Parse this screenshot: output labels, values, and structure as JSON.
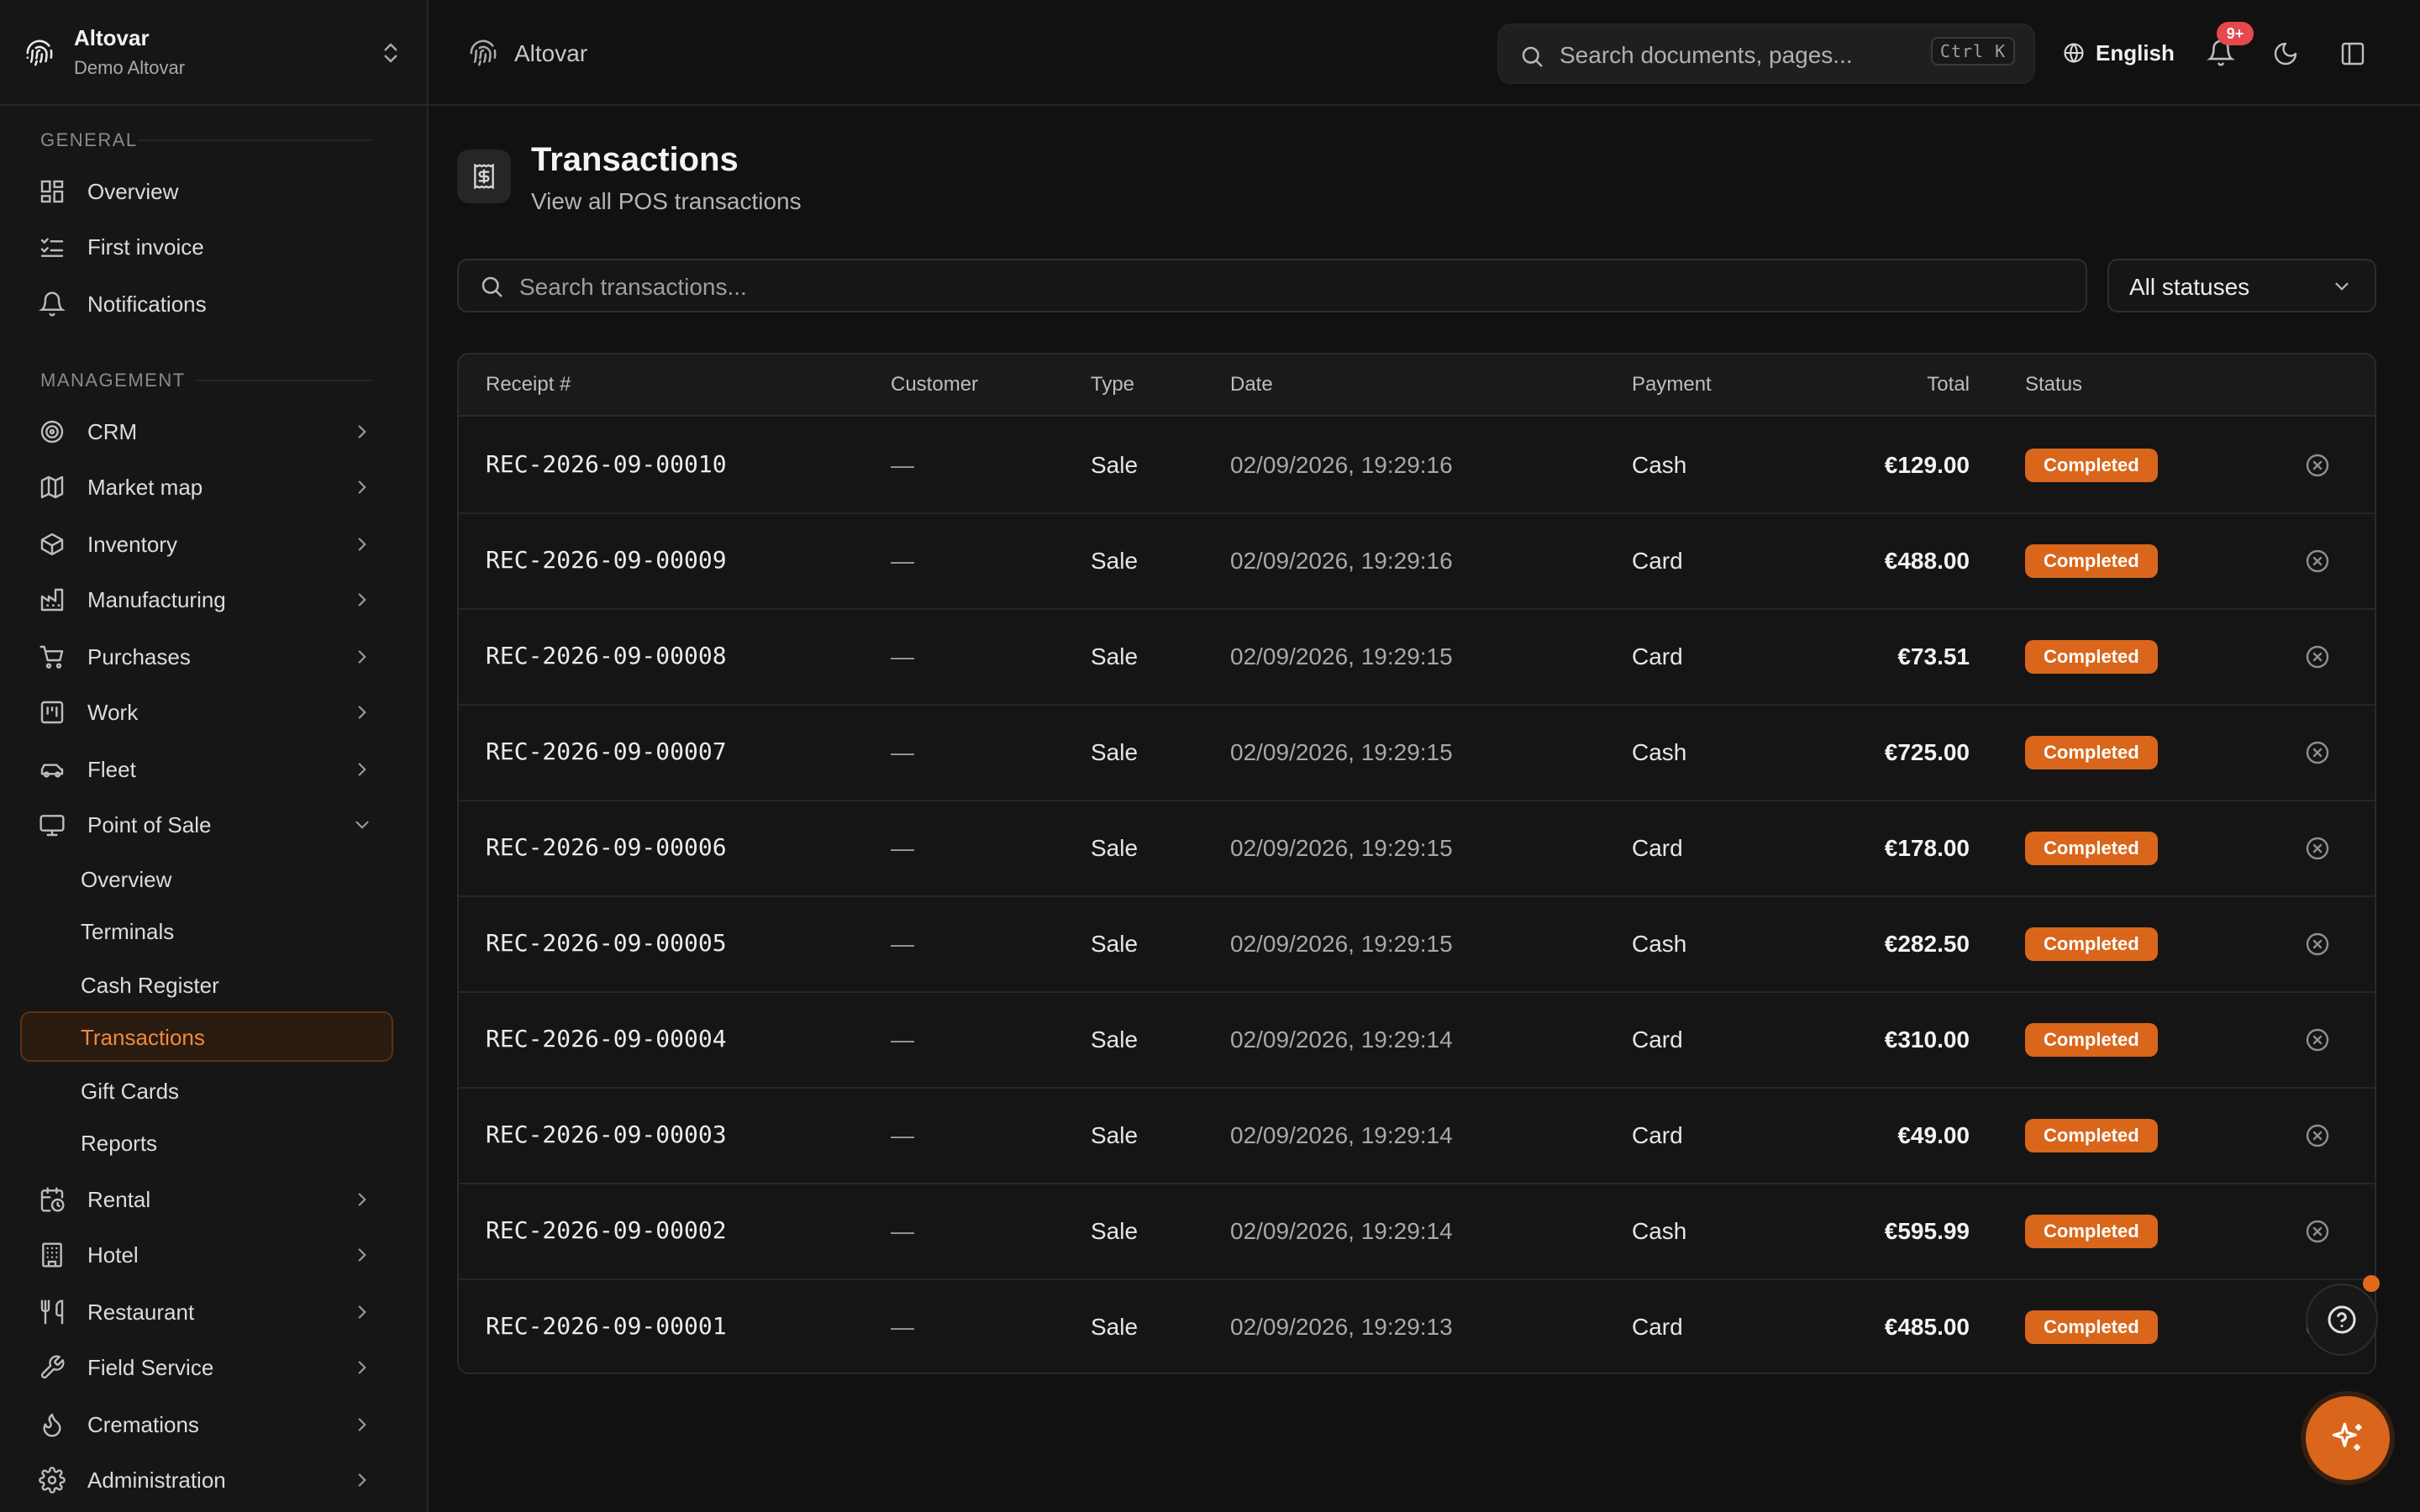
{
  "workspace": {
    "name": "Altovar",
    "subtitle": "Demo Altovar"
  },
  "sidebar": {
    "general_label": "GENERAL",
    "general_items": [
      {
        "label": "Overview",
        "icon": "dashboard-icon"
      },
      {
        "label": "First invoice",
        "icon": "list-check-icon"
      },
      {
        "label": "Notifications",
        "icon": "bell-icon"
      }
    ],
    "management_label": "MANAGEMENT",
    "management_items": [
      {
        "label": "CRM",
        "icon": "target-icon"
      },
      {
        "label": "Market map",
        "icon": "map-icon"
      },
      {
        "label": "Inventory",
        "icon": "box-icon"
      },
      {
        "label": "Manufacturing",
        "icon": "factory-icon"
      },
      {
        "label": "Purchases",
        "icon": "cart-icon"
      },
      {
        "label": "Work",
        "icon": "kanban-icon"
      },
      {
        "label": "Fleet",
        "icon": "car-icon"
      },
      {
        "label": "Point of Sale",
        "icon": "monitor-icon",
        "expanded": true
      },
      {
        "label": "Rental",
        "icon": "calendar-clock-icon"
      },
      {
        "label": "Hotel",
        "icon": "building-icon"
      },
      {
        "label": "Restaurant",
        "icon": "utensils-icon"
      },
      {
        "label": "Field Service",
        "icon": "wrench-icon"
      },
      {
        "label": "Cremations",
        "icon": "flame-icon"
      },
      {
        "label": "Administration",
        "icon": "gear-icon"
      }
    ],
    "pos_subitems": [
      {
        "label": "Overview"
      },
      {
        "label": "Terminals"
      },
      {
        "label": "Cash Register"
      },
      {
        "label": "Transactions",
        "active": true
      },
      {
        "label": "Gift Cards"
      },
      {
        "label": "Reports"
      }
    ]
  },
  "topbar": {
    "breadcrumb": "Altovar",
    "search_placeholder": "Search documents, pages...",
    "search_shortcut": "Ctrl K",
    "language": "English",
    "notification_badge": "9+"
  },
  "page": {
    "title": "Transactions",
    "subtitle": "View all POS transactions",
    "search_placeholder": "Search transactions...",
    "status_filter": "All statuses"
  },
  "table": {
    "headers": {
      "receipt": "Receipt #",
      "customer": "Customer",
      "type": "Type",
      "date": "Date",
      "payment": "Payment",
      "total": "Total",
      "status": "Status"
    },
    "rows": [
      {
        "receipt": "REC-2026-09-00010",
        "customer": "—",
        "type": "Sale",
        "date": "02/09/2026, 19:29:16",
        "payment": "Cash",
        "total": "€129.00",
        "status": "Completed"
      },
      {
        "receipt": "REC-2026-09-00009",
        "customer": "—",
        "type": "Sale",
        "date": "02/09/2026, 19:29:16",
        "payment": "Card",
        "total": "€488.00",
        "status": "Completed"
      },
      {
        "receipt": "REC-2026-09-00008",
        "customer": "—",
        "type": "Sale",
        "date": "02/09/2026, 19:29:15",
        "payment": "Card",
        "total": "€73.51",
        "status": "Completed"
      },
      {
        "receipt": "REC-2026-09-00007",
        "customer": "—",
        "type": "Sale",
        "date": "02/09/2026, 19:29:15",
        "payment": "Cash",
        "total": "€725.00",
        "status": "Completed"
      },
      {
        "receipt": "REC-2026-09-00006",
        "customer": "—",
        "type": "Sale",
        "date": "02/09/2026, 19:29:15",
        "payment": "Card",
        "total": "€178.00",
        "status": "Completed"
      },
      {
        "receipt": "REC-2026-09-00005",
        "customer": "—",
        "type": "Sale",
        "date": "02/09/2026, 19:29:15",
        "payment": "Cash",
        "total": "€282.50",
        "status": "Completed"
      },
      {
        "receipt": "REC-2026-09-00004",
        "customer": "—",
        "type": "Sale",
        "date": "02/09/2026, 19:29:14",
        "payment": "Card",
        "total": "€310.00",
        "status": "Completed"
      },
      {
        "receipt": "REC-2026-09-00003",
        "customer": "—",
        "type": "Sale",
        "date": "02/09/2026, 19:29:14",
        "payment": "Card",
        "total": "€49.00",
        "status": "Completed"
      },
      {
        "receipt": "REC-2026-09-00002",
        "customer": "—",
        "type": "Sale",
        "date": "02/09/2026, 19:29:14",
        "payment": "Cash",
        "total": "€595.99",
        "status": "Completed"
      },
      {
        "receipt": "REC-2026-09-00001",
        "customer": "—",
        "type": "Sale",
        "date": "02/09/2026, 19:29:13",
        "payment": "Card",
        "total": "€485.00",
        "status": "Completed"
      }
    ]
  },
  "colors": {
    "accent": "#d9661a",
    "background": "#111111",
    "sidebar": "#161616",
    "badge_red": "#e5484d"
  }
}
